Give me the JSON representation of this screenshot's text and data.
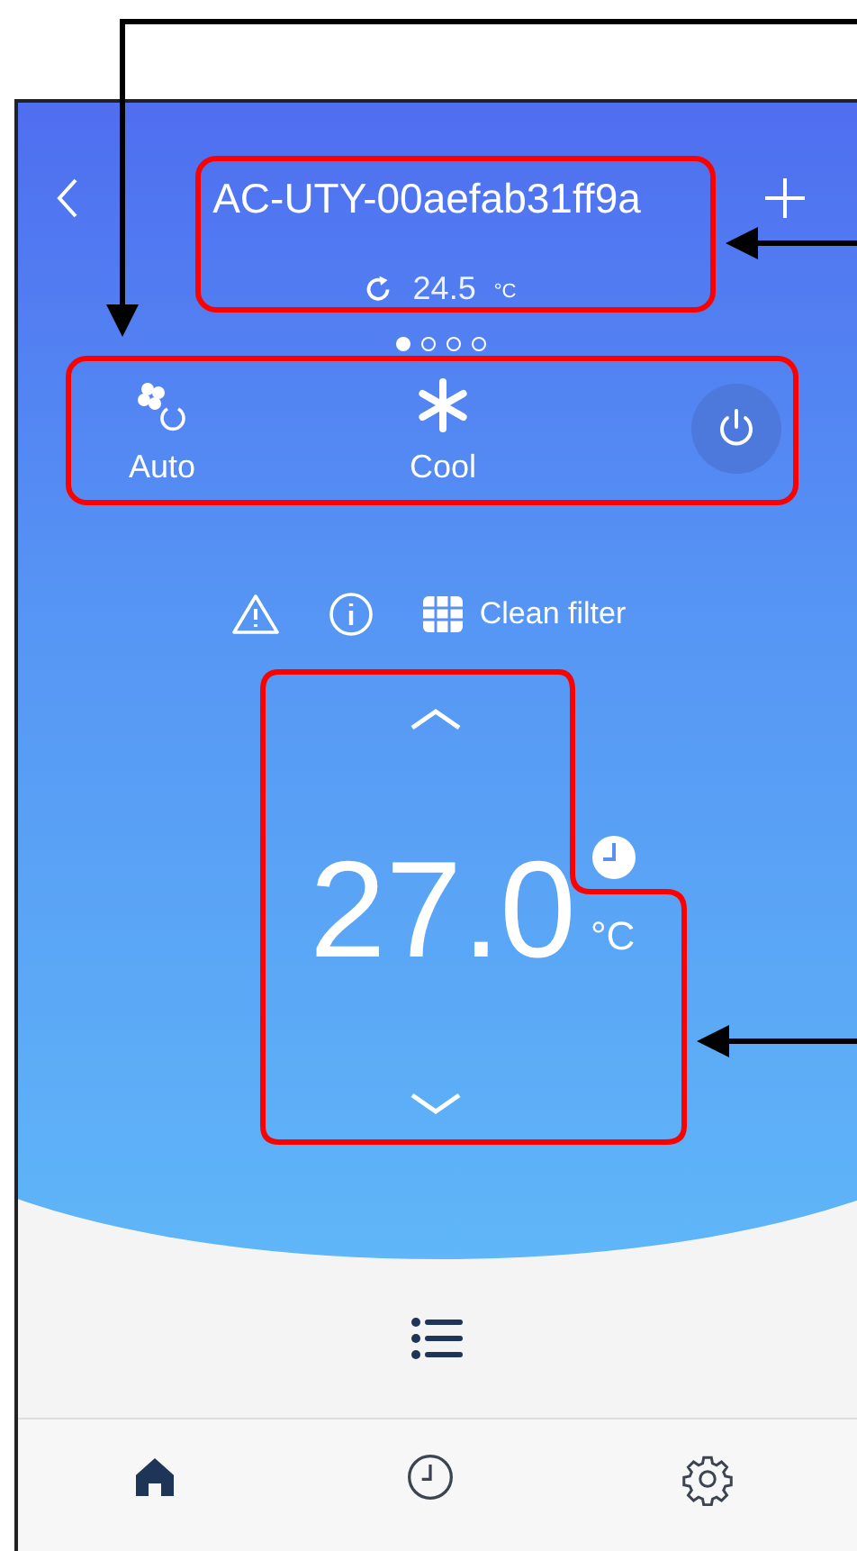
{
  "header": {
    "title": "AC-UTY-00aefab31ff9a",
    "current_temperature": "24.5",
    "current_unit": "°C"
  },
  "pager": [
    {
      "selected": true
    },
    {
      "selected": false
    },
    {
      "selected": false
    },
    {
      "selected": false
    }
  ],
  "controls": {
    "fan": "Auto",
    "mode": "Cool"
  },
  "status": {
    "label": "Clean filter"
  },
  "setpoint": {
    "value": "27.0",
    "unit": "°C"
  },
  "tabs": [
    {
      "kind": "home",
      "selected": true
    },
    {
      "kind": "timer",
      "selected": false
    },
    {
      "kind": "settings",
      "selected": false
    }
  ]
}
